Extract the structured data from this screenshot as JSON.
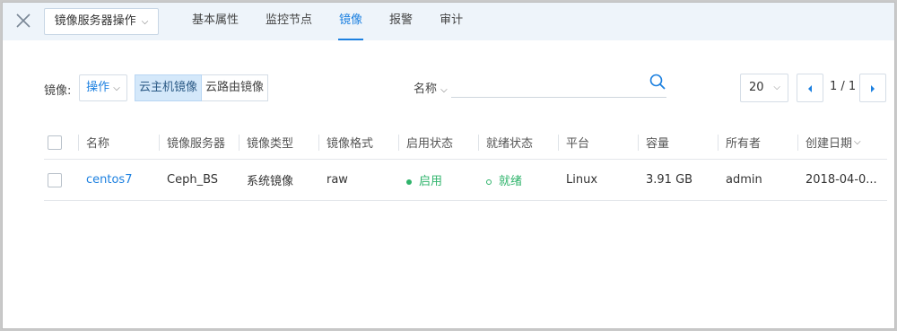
{
  "header": {
    "close_icon": "close-icon",
    "ops_button_label": "镜像服务器操作",
    "tabs": [
      {
        "label": "基本属性",
        "active": false
      },
      {
        "label": "监控节点",
        "active": false
      },
      {
        "label": "镜像",
        "active": true
      },
      {
        "label": "报警",
        "active": false
      },
      {
        "label": "审计",
        "active": false
      }
    ]
  },
  "toolbar": {
    "label": "镜像:",
    "operation_dropdown": "操作",
    "segments": [
      {
        "label": "云主机镜像",
        "active": true
      },
      {
        "label": "云路由镜像",
        "active": false
      }
    ],
    "search_field_label": "名称",
    "search_value": "",
    "search_placeholder": "",
    "page_size": "20",
    "page_indicator": "1 / 1"
  },
  "table": {
    "columns": [
      "名称",
      "镜像服务器",
      "镜像类型",
      "镜像格式",
      "启用状态",
      "就绪状态",
      "平台",
      "容量",
      "所有者",
      "创建日期"
    ],
    "rows": [
      {
        "name": "centos7",
        "server": "Ceph_BS",
        "type": "系统镜像",
        "format": "raw",
        "enable_state": "启用",
        "ready_state": "就绪",
        "platform": "Linux",
        "capacity": "3.91 GB",
        "owner": "admin",
        "created": "2018-04-0..."
      }
    ]
  },
  "colors": {
    "accent": "#1c80e0",
    "status_green": "#2fb36b",
    "topbar_bg": "#eef4fa",
    "segment_active_bg": "#d4e8fa"
  }
}
